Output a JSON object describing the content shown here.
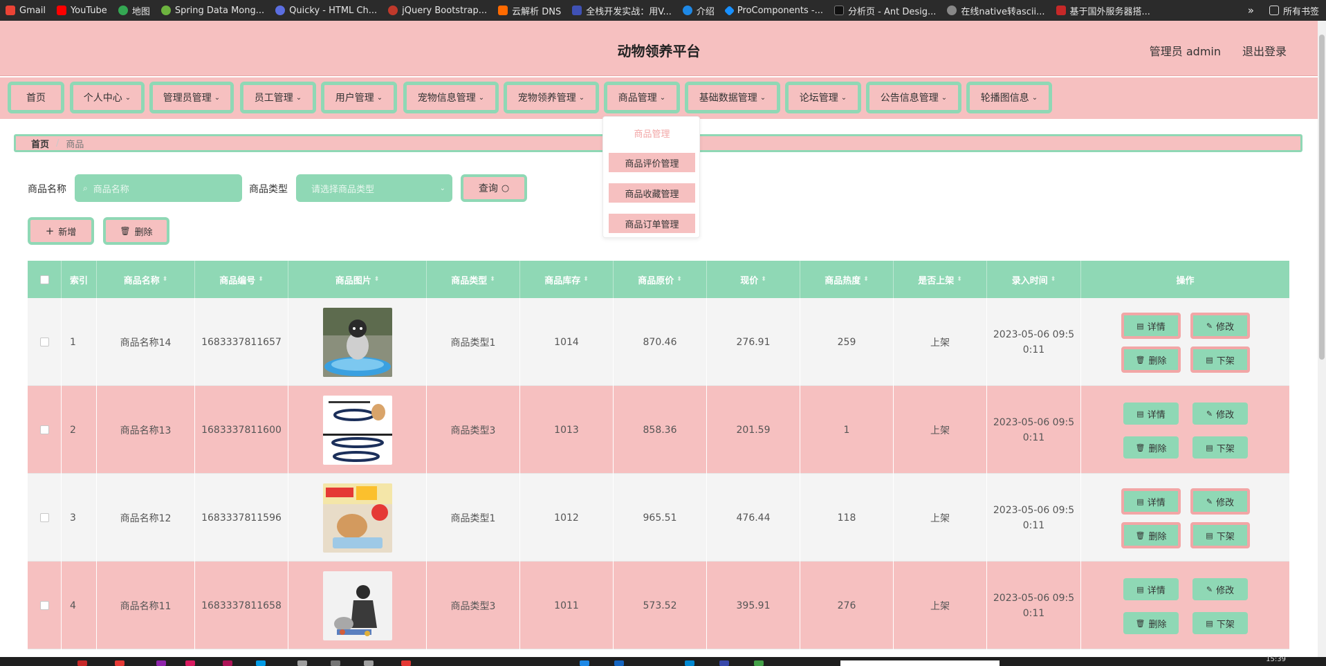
{
  "bookmarks": [
    {
      "label": "Gmail",
      "color": "#ea4335"
    },
    {
      "label": "YouTube",
      "color": "#ff0000"
    },
    {
      "label": "地图",
      "color": "#34a853"
    },
    {
      "label": "Spring Data Mong...",
      "color": "#6db33f"
    },
    {
      "label": "Quicky - HTML Ch...",
      "color": "#5b6ee1"
    },
    {
      "label": "jQuery Bootstrap...",
      "color": "#c0392b"
    },
    {
      "label": "云解析 DNS",
      "color": "#ff6a00"
    },
    {
      "label": "全栈开发实战：用V...",
      "color": "#3f51b5"
    },
    {
      "label": "介绍",
      "color": "#1e88e5"
    },
    {
      "label": "ProComponents -...",
      "color": "#1890ff"
    },
    {
      "label": "分析页 - Ant Desig...",
      "color": "#111111"
    },
    {
      "label": "在线native转ascii...",
      "color": "#888888"
    },
    {
      "label": "基于国外服务器搭...",
      "color": "#c62828"
    }
  ],
  "bookmarks_right": {
    "more": "»",
    "all": "所有书签"
  },
  "header": {
    "title": "动物领养平台",
    "user": "管理员 admin",
    "logout": "退出登录"
  },
  "nav": [
    {
      "label": "首页",
      "has_menu": false
    },
    {
      "label": "个人中心",
      "has_menu": true
    },
    {
      "label": "管理员管理",
      "has_menu": true
    },
    {
      "label": "员工管理",
      "has_menu": true
    },
    {
      "label": "用户管理",
      "has_menu": true
    },
    {
      "label": "宠物信息管理",
      "has_menu": true
    },
    {
      "label": "宠物领养管理",
      "has_menu": true
    },
    {
      "label": "商品管理",
      "has_menu": true
    },
    {
      "label": "基础数据管理",
      "has_menu": true
    },
    {
      "label": "论坛管理",
      "has_menu": true
    },
    {
      "label": "公告信息管理",
      "has_menu": true
    },
    {
      "label": "轮播图信息",
      "has_menu": true
    }
  ],
  "dropdown": [
    "商品管理",
    "商品评价管理",
    "商品收藏管理",
    "商品订单管理"
  ],
  "breadcrumb": {
    "home": "首页",
    "separator": "/",
    "current": "商品"
  },
  "search": {
    "name_label": "商品名称",
    "name_placeholder": "商品名称",
    "type_label": "商品类型",
    "type_placeholder": "请选择商品类型",
    "query_label": "查询"
  },
  "actions": {
    "add": "新增",
    "delete": "删除"
  },
  "table": {
    "headers": [
      "索引",
      "商品名称",
      "商品编号",
      "商品图片",
      "商品类型",
      "商品库存",
      "商品原价",
      "现价",
      "商品热度",
      "是否上架",
      "录入时间",
      "操作"
    ],
    "rows": [
      {
        "index": "1",
        "name": "商品名称14",
        "code": "1683337811657",
        "type": "商品类型1",
        "stock": "1014",
        "original_price": "870.46",
        "price": "276.91",
        "heat": "259",
        "on_sale": "上架",
        "time_line1": "2023-05-06 09:5",
        "time_line2": "0:11"
      },
      {
        "index": "2",
        "name": "商品名称13",
        "code": "1683337811600",
        "type": "商品类型3",
        "stock": "1013",
        "original_price": "858.36",
        "price": "201.59",
        "heat": "1",
        "on_sale": "上架",
        "time_line1": "2023-05-06 09:5",
        "time_line2": "0:11"
      },
      {
        "index": "3",
        "name": "商品名称12",
        "code": "1683337811596",
        "type": "商品类型1",
        "stock": "1012",
        "original_price": "965.51",
        "price": "476.44",
        "heat": "118",
        "on_sale": "上架",
        "time_line1": "2023-05-06 09:5",
        "time_line2": "0:11"
      },
      {
        "index": "4",
        "name": "商品名称11",
        "code": "1683337811658",
        "type": "商品类型3",
        "stock": "1011",
        "original_price": "573.52",
        "price": "395.91",
        "heat": "276",
        "on_sale": "上架",
        "time_line1": "2023-05-06 09:5",
        "time_line2": "0:11"
      }
    ],
    "row_actions": {
      "detail": "详情",
      "edit": "修改",
      "delete": "删除",
      "offshelf": "下架"
    }
  },
  "taskbar": {
    "time": "15:39"
  },
  "colors": {
    "pink": "#f6c0c0",
    "mint": "#8fd8b5",
    "pink_border": "#f2a6a6"
  }
}
